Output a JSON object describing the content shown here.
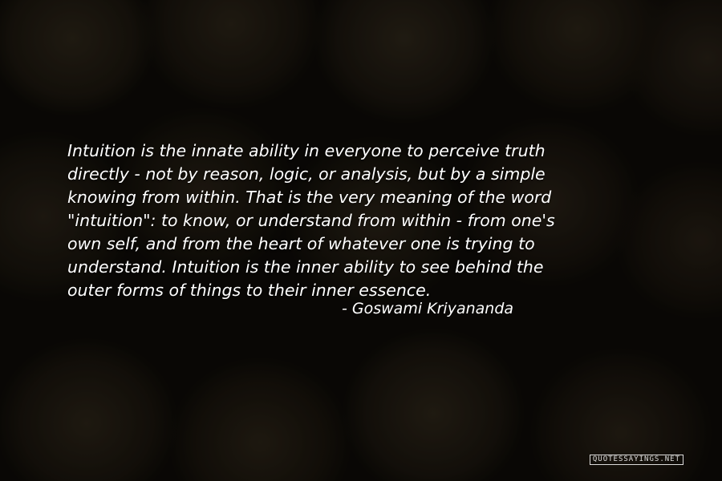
{
  "quote": {
    "text": "Intuition is the innate ability in everyone to perceive truth\ndirectly - not by reason, logic, or analysis, but by a simple\nknowing from within. That is the very meaning of the word\n\"intuition\": to know, or understand from within - from one's\nown self, and from the heart of whatever one is trying to\nunderstand. Intuition is the inner ability to see behind the\nouter forms of things to their inner essence.",
    "author": "- Goswami Kriyananda"
  },
  "watermark": {
    "text": "QUOTESSAYINGS.NET"
  },
  "colors": {
    "text": "#ffffff",
    "background": "#0d0b07"
  }
}
